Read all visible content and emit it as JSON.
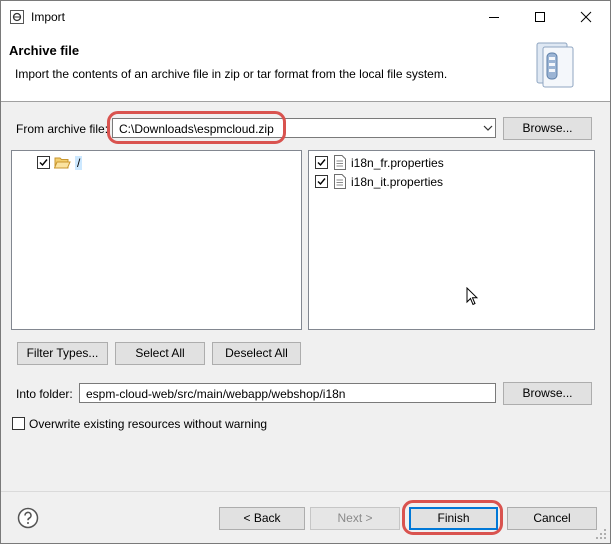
{
  "window": {
    "title": "Import"
  },
  "banner": {
    "title": "Archive file",
    "description": "Import the contents of an archive file in zip or tar format from the local file system."
  },
  "archive": {
    "label": "From archive file:",
    "value": "C:\\Downloads\\espmcloud.zip",
    "browse_label": "Browse..."
  },
  "tree": {
    "items": [
      {
        "label": "/",
        "checked": true
      }
    ]
  },
  "files": {
    "items": [
      {
        "label": "i18n_fr.properties",
        "checked": true
      },
      {
        "label": "i18n_it.properties",
        "checked": true
      }
    ]
  },
  "selection_buttons": {
    "filter_types": "Filter Types...",
    "select_all": "Select All",
    "deselect_all": "Deselect All"
  },
  "folder": {
    "label": "Into folder:",
    "value": "espm-cloud-web/src/main/webapp/webshop/i18n",
    "browse_label": "Browse..."
  },
  "overwrite": {
    "label": "Overwrite existing resources without warning",
    "checked": false
  },
  "footer": {
    "back": "< Back",
    "next": "Next >",
    "finish": "Finish",
    "cancel": "Cancel"
  },
  "colors": {
    "highlight": "#d9534f",
    "default_button_border": "#0078d7",
    "folder_icon": "#e8b64c"
  }
}
